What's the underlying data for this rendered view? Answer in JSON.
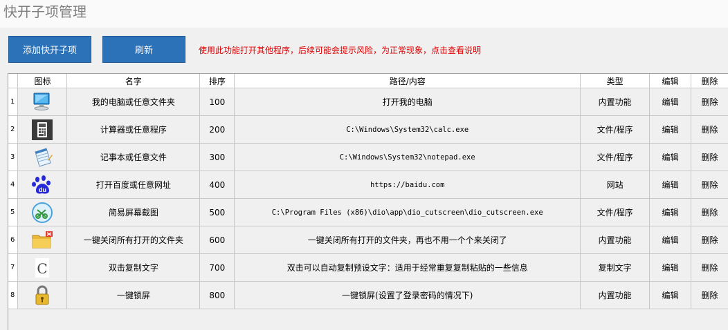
{
  "page": {
    "title": "快开子项管理"
  },
  "toolbar": {
    "add_label": "添加快开子项",
    "refresh_label": "刷新",
    "warning": "使用此功能打开其他程序，后续可能会提示风险，为正常现象，点击查看说明"
  },
  "table": {
    "headers": {
      "icon": "图标",
      "name": "名字",
      "order": "排序",
      "path": "路径/内容",
      "type": "类型",
      "edit": "编辑",
      "delete": "删除"
    },
    "rows": [
      {
        "index": "1",
        "icon": "computer-icon",
        "name": "我的电脑或任意文件夹",
        "order": "100",
        "path": "打开我的电脑",
        "mono": false,
        "type": "内置功能",
        "edit": "编辑",
        "delete": "删除"
      },
      {
        "index": "2",
        "icon": "calculator-icon",
        "name": "计算器或任意程序",
        "order": "200",
        "path": "C:\\Windows\\System32\\calc.exe",
        "mono": true,
        "type": "文件/程序",
        "edit": "编辑",
        "delete": "删除"
      },
      {
        "index": "3",
        "icon": "notepad-icon",
        "name": "记事本或任意文件",
        "order": "300",
        "path": "C:\\Windows\\System32\\notepad.exe",
        "mono": true,
        "type": "文件/程序",
        "edit": "编辑",
        "delete": "删除"
      },
      {
        "index": "4",
        "icon": "baidu-icon",
        "name": "打开百度或任意网址",
        "order": "400",
        "path": "https://baidu.com",
        "mono": true,
        "type": "网站",
        "edit": "编辑",
        "delete": "删除"
      },
      {
        "index": "5",
        "icon": "screenshot-icon",
        "name": "简易屏幕截图",
        "order": "500",
        "path": "C:\\Program Files (x86)\\dio\\app\\dio_cutscreen\\dio_cutscreen.exe",
        "mono": true,
        "type": "文件/程序",
        "edit": "编辑",
        "delete": "删除"
      },
      {
        "index": "6",
        "icon": "close-folder-icon",
        "name": "一键关闭所有打开的文件夹",
        "order": "600",
        "path": "一键关闭所有打开的文件夹，再也不用一个个来关闭了",
        "mono": false,
        "type": "内置功能",
        "edit": "编辑",
        "delete": "删除"
      },
      {
        "index": "7",
        "icon": "copy-text-icon",
        "name": "双击复制文字",
        "order": "700",
        "path": "双击可以自动复制预设文字：适用于经常重复复制粘贴的一些信息",
        "mono": false,
        "type": "复制文字",
        "edit": "编辑",
        "delete": "删除"
      },
      {
        "index": "8",
        "icon": "lock-icon",
        "name": "一键锁屏",
        "order": "800",
        "path": "一键锁屏(设置了登录密码的情况下)",
        "mono": false,
        "type": "内置功能",
        "edit": "编辑",
        "delete": "删除"
      }
    ]
  }
}
